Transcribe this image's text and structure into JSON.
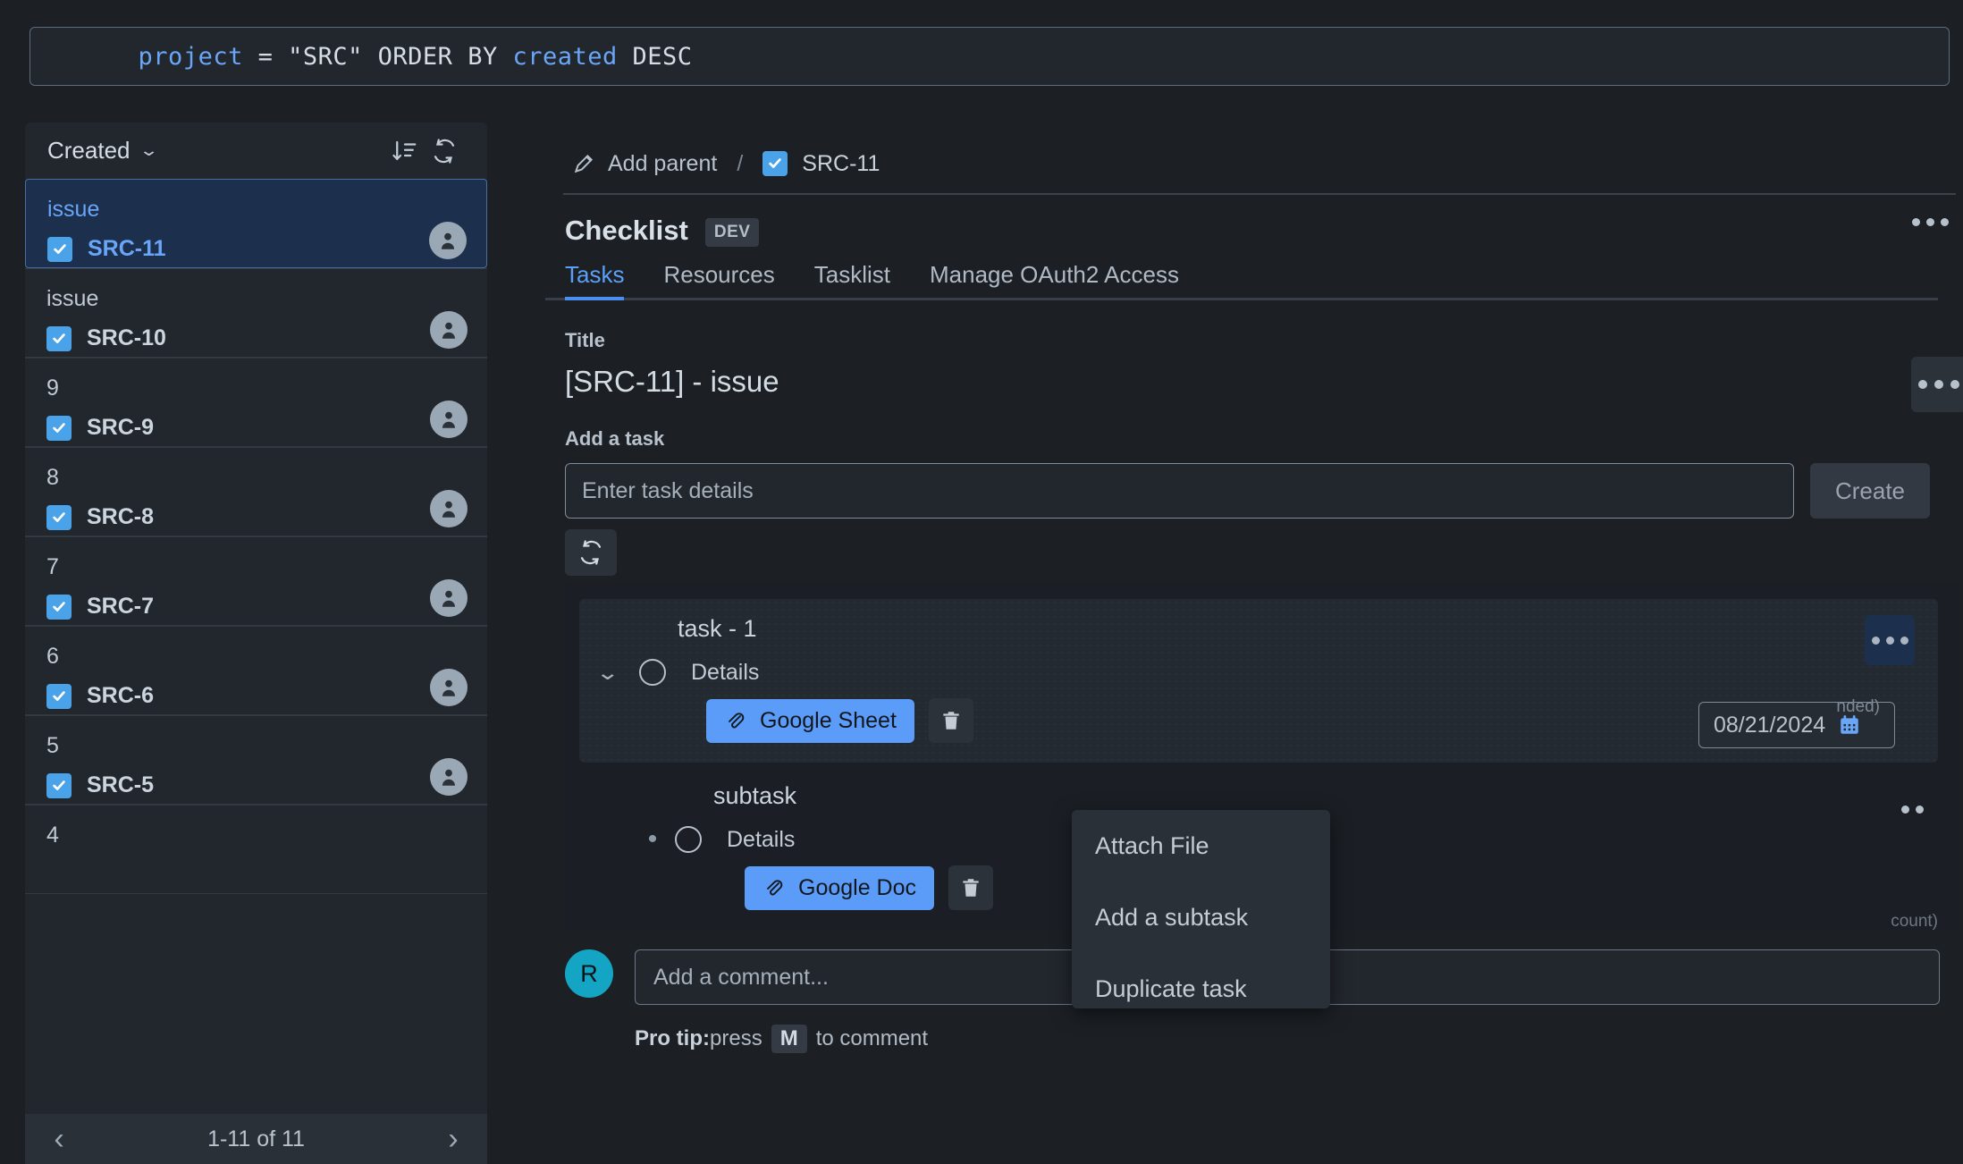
{
  "query_bar": {
    "tokens": [
      {
        "t": "project",
        "kw": true
      },
      {
        "t": " = ",
        "kw": false
      },
      {
        "t": "\"SRC\" ORDER BY ",
        "kw": false
      },
      {
        "t": "created",
        "kw": true
      },
      {
        "t": " DESC",
        "kw": false
      }
    ],
    "full_text": "project = \"SRC\" ORDER BY created DESC"
  },
  "sidebar": {
    "sort_label": "Created",
    "sort_icon": "sort-descending-icon",
    "refresh_icon": "refresh-icon",
    "items": [
      {
        "summary": "issue",
        "key": "SRC-11",
        "selected": true
      },
      {
        "summary": "issue",
        "key": "SRC-10",
        "selected": false
      },
      {
        "summary": "9",
        "key": "SRC-9",
        "selected": false
      },
      {
        "summary": "8",
        "key": "SRC-8",
        "selected": false
      },
      {
        "summary": "7",
        "key": "SRC-7",
        "selected": false
      },
      {
        "summary": "6",
        "key": "SRC-6",
        "selected": false
      },
      {
        "summary": "5",
        "key": "SRC-5",
        "selected": false
      },
      {
        "summary": "4",
        "key": "",
        "selected": false
      }
    ],
    "pager": {
      "prev": "‹",
      "label": "1-11 of 11",
      "next": "›"
    }
  },
  "breadcrumb": {
    "pencil_icon": "pencil-icon",
    "add_parent": "Add parent",
    "separator": "/",
    "issue_key": "SRC-11"
  },
  "panel": {
    "title": "Checklist",
    "badge": "DEV",
    "tabs": [
      {
        "label": "Tasks",
        "active": true
      },
      {
        "label": "Resources",
        "active": false
      },
      {
        "label": "Tasklist",
        "active": false
      },
      {
        "label": "Manage OAuth2 Access",
        "active": false
      }
    ]
  },
  "title_field": {
    "label": "Title",
    "value": "[SRC-11] - issue"
  },
  "add_task": {
    "label": "Add a task",
    "placeholder": "Enter task details",
    "value": "",
    "create_label": "Create",
    "refresh_icon": "refresh-icon"
  },
  "task": {
    "name": "task - 1",
    "details_label": "Details",
    "attachment": "Google Sheet",
    "attach_icon": "paperclip-icon",
    "delete_icon": "trash-icon",
    "caret_icon": "chevron-down-icon",
    "due_date": "08/21/2024",
    "calendar_icon": "calendar-icon",
    "clipped_right_text": "nded)"
  },
  "subtask": {
    "name": "subtask",
    "details_label": "Details",
    "attachment": "Google Doc",
    "attach_icon": "paperclip-icon",
    "delete_icon": "trash-icon",
    "bullet": "•",
    "clipped_right_text": "count)"
  },
  "context_menu": {
    "items": [
      {
        "label": "Attach File"
      },
      {
        "label": "Add a subtask"
      },
      {
        "label": "Duplicate task"
      }
    ]
  },
  "comment": {
    "avatar_initial": "R",
    "placeholder": "Add a comment...",
    "value": "",
    "protip_prefix": "Pro tip:",
    "protip_mid": " press ",
    "protip_key": "M",
    "protip_suffix": " to comment"
  },
  "colors": {
    "accent_blue": "#5b9cf8",
    "selected_row": "#1c2f4d",
    "checkbox_blue": "#4aa3e8",
    "avatar_teal": "#14a5c4",
    "page_bg": "#1c2025",
    "panel_bg": "#22272d"
  }
}
